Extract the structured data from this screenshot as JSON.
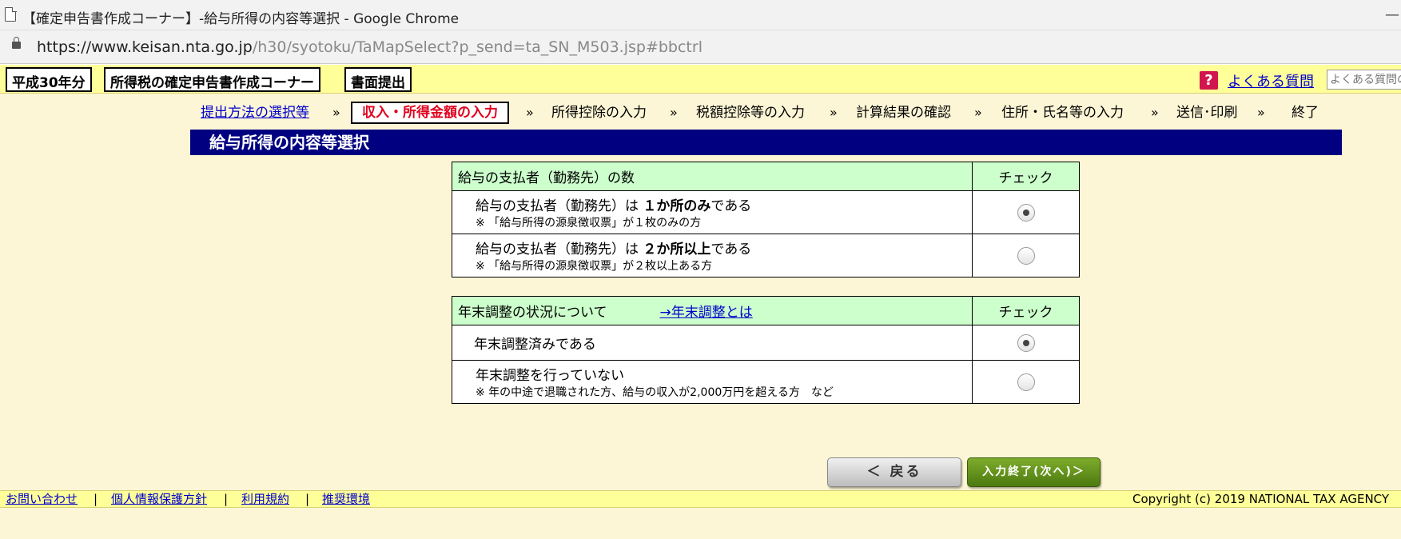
{
  "window": {
    "title": "【確定申告書作成コーナー】-給与所得の内容等選択 - Google Chrome",
    "minimize": "—"
  },
  "address_bar": {
    "url_host": "https://www.keisan.nta.go.jp",
    "url_path": "/h30/syotoku/TaMapSelect?p_send=ta_SN_M503.jsp#bbctrl"
  },
  "topbar": {
    "year": "平成30年分",
    "corner": "所得税の確定申告書作成コーナー",
    "submission": "書面提出",
    "help_glyph": "?",
    "faq_label": "よくある質問",
    "faq_search_placeholder": "よくある質問の検索"
  },
  "steps": {
    "items": [
      "提出方法の選択等",
      "収入・所得金額の入力",
      "所得控除の入力",
      "税額控除等の入力",
      "計算結果の確認",
      "住所・氏名等の入力",
      "送信･印刷",
      "終了"
    ],
    "separator": "»"
  },
  "page_title": "給与所得の内容等選択",
  "payer_table": {
    "header": "給与の支払者（勤務先）の数",
    "check_header": "チェック",
    "options": [
      {
        "prefix": "給与の支払者（勤務先）は ",
        "bold": "１か所のみ",
        "suffix": "である",
        "note": "※ 「給与所得の源泉徴収票」が１枚のみの方",
        "checked": true
      },
      {
        "prefix": "給与の支払者（勤務先）は ",
        "bold": "２か所以上",
        "suffix": "である",
        "note": "※ 「給与所得の源泉徴収票」が２枚以上ある方",
        "checked": false
      }
    ]
  },
  "yearend_table": {
    "header": "年末調整の状況について",
    "link": "→年末調整とは",
    "check_header": "チェック",
    "options": [
      {
        "label": "年末調整済みである",
        "checked": true
      },
      {
        "label": "年末調整を行っていない",
        "note": "※ 年の中途で退職された方、給与の収入が2,000万円を超える方　など",
        "checked": false
      }
    ]
  },
  "buttons": {
    "back": "＜ 戻る",
    "next": "入力終了(次へ)＞"
  },
  "footer": {
    "links": [
      "お問い合わせ",
      "個人情報保護方針",
      "利用規約",
      "推奨環境"
    ],
    "separator": "|",
    "copyright": "Copyright (c) 2019 NATIONAL TAX AGENCY"
  }
}
